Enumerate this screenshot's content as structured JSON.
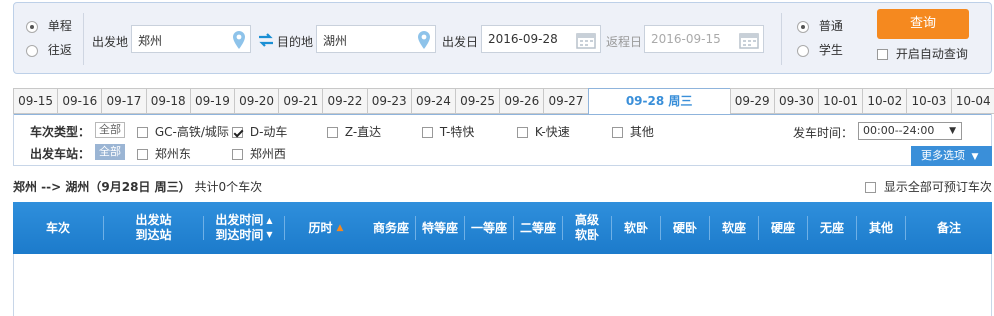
{
  "search": {
    "trip_type": {
      "one_way": "单程",
      "round_trip": "往返",
      "selected": "one_way"
    },
    "from_label": "出发地",
    "from_value": "郑州",
    "to_label": "目的地",
    "to_value": "湖州",
    "depart_label": "出发日",
    "depart_value": "2016-09-28",
    "return_label": "返程日",
    "return_value": "2016-09-15",
    "passenger": {
      "normal": "普通",
      "student": "学生",
      "selected": "normal"
    },
    "query_button": "查询",
    "auto_query_label": "开启自动查询"
  },
  "date_tabs": [
    "09-15",
    "09-16",
    "09-17",
    "09-18",
    "09-19",
    "09-20",
    "09-21",
    "09-22",
    "09-23",
    "09-24",
    "09-25",
    "09-26",
    "09-27",
    "09-28 周三",
    "09-29",
    "09-30",
    "10-01",
    "10-02",
    "10-03",
    "10-04"
  ],
  "active_tab": "09-28 周三",
  "filters": {
    "train_type_label": "车次类型：",
    "all_label": "全部",
    "train_types": [
      {
        "label": "GC-高铁/城际",
        "checked": false
      },
      {
        "label": "D-动车",
        "checked": true
      },
      {
        "label": "Z-直达",
        "checked": false
      },
      {
        "label": "T-特快",
        "checked": false
      },
      {
        "label": "K-快速",
        "checked": false
      },
      {
        "label": "其他",
        "checked": false
      }
    ],
    "station_label": "出发车站：",
    "station_all_label": "全部",
    "stations": [
      {
        "label": "郑州东",
        "checked": false
      },
      {
        "label": "郑州西",
        "checked": false
      }
    ],
    "depart_time_label": "发车时间：",
    "depart_time_value": "00:00--24:00",
    "more_options": "更多选项"
  },
  "result": {
    "route": "郑州 --> 湖州（9月28日  周三）",
    "count_text": "共计0个车次",
    "show_all_label": "显示全部可预订车次"
  },
  "table": {
    "headers": {
      "train": "车次",
      "station_from": "出发站",
      "station_to": "到达站",
      "time_depart": "出发时间",
      "time_arrive": "到达时间",
      "duration": "历时",
      "business": "商务座",
      "special": "特等座",
      "first": "一等座",
      "second": "二等座",
      "soft_sleeper_hi_1": "高级",
      "soft_sleeper_hi_2": "软卧",
      "soft_sleeper": "软卧",
      "hard_sleeper": "硬卧",
      "soft_seat": "软座",
      "hard_seat": "硬座",
      "no_seat": "无座",
      "other": "其他",
      "remark": "备注"
    }
  },
  "colors": {
    "accent": "#3a8fd9",
    "header_bg": "#2585d4",
    "query_button": "#f5891f",
    "panel_bg": "#eef1f8"
  }
}
